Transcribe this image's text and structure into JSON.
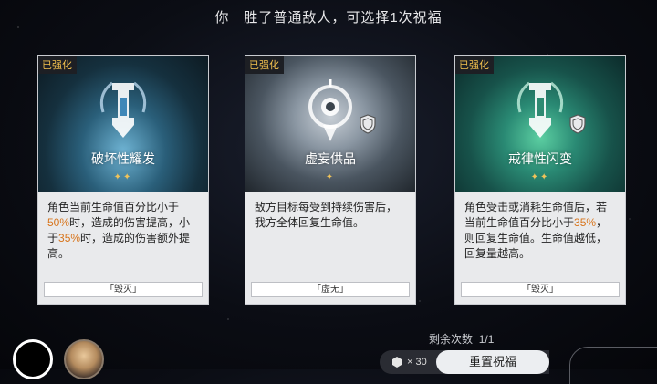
{
  "header": {
    "title": "你　胜了普通敌人，可选择1次祝福"
  },
  "cards": [
    {
      "tag": "已强化",
      "name": "破坏性耀发",
      "desc_parts": [
        "角色当前生命值百分比小于",
        "50%",
        "时，造成的伤害提高，小于",
        "35%",
        "时，造成的伤害额外提高。"
      ],
      "path": "「毁灭」",
      "stars": "✦✦",
      "theme": "blue"
    },
    {
      "tag": "已强化",
      "name": "虚妄供品",
      "desc_parts": [
        "敌方目标每受到持续伤害后，我方全体回复生命值。"
      ],
      "path": "「虚无」",
      "stars": "✦",
      "theme": "grey"
    },
    {
      "tag": "已强化",
      "name": "戒律性闪变",
      "desc_parts": [
        "角色受击或消耗生命值后，若当前生命值百分比小于",
        "35%",
        "，则回复生命值。生命值越低，回复量越高。"
      ],
      "path": "「毁灭」",
      "stars": "✦✦",
      "theme": "green"
    }
  ],
  "footer": {
    "remaining_label": "剩余次数",
    "remaining_value": "1/1",
    "cost": "× 30",
    "reset_label": "重置祝福"
  },
  "colors": {
    "highlight": "#d8751c",
    "tag": "#f2c14e"
  }
}
